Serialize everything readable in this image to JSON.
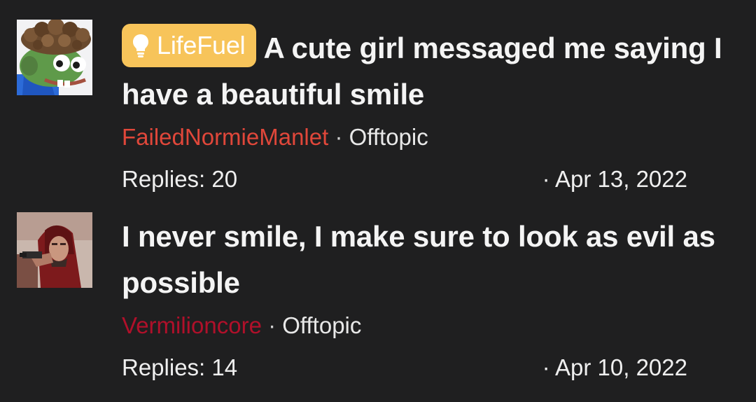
{
  "threads": [
    {
      "prefix": "LifeFuel",
      "title": "A cute girl messaged me saying I have a beautiful smile",
      "author": "FailedNormieManlet",
      "separator": "·",
      "forum": "Offtopic",
      "replies": "Replies: 20",
      "date": "· Apr 13, 2022",
      "author_color": "#e0473a",
      "prefix_color": "#f7c45a",
      "avatar_icon": "pepe-frog-avatar"
    },
    {
      "title": "I never smile, I make sure to look as evil as possible",
      "author": "Vermilioncore",
      "separator": "·",
      "forum": "Offtopic",
      "replies": "Replies: 14",
      "date": "· Apr 10, 2022",
      "author_color": "#b0102a",
      "avatar_icon": "hooded-man-avatar"
    }
  ],
  "colors": {
    "background": "#1f1f20",
    "text": "#f4f4f4"
  }
}
